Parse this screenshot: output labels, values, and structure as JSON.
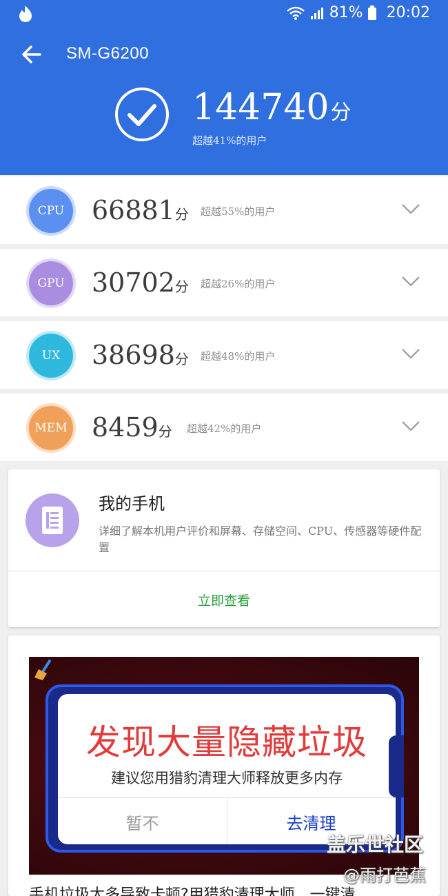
{
  "status_bar": {
    "battery": "81%",
    "time": "20:02",
    "icons": [
      "flame-icon",
      "wifi-icon",
      "signal-icon",
      "battery-icon"
    ]
  },
  "header": {
    "device": "SM-G6200",
    "total_score": "144740",
    "score_unit": "分",
    "beat_text": "超越41%的用户",
    "colors": {
      "background": "#2f6fe0"
    }
  },
  "scores": [
    {
      "badge": "CPU",
      "score": "66881",
      "unit": "分",
      "beat": "超越55%的用户"
    },
    {
      "badge": "GPU",
      "score": "30702",
      "unit": "分",
      "beat": "超越26%的用户"
    },
    {
      "badge": "UX",
      "score": "38698",
      "unit": "分",
      "beat": "超越48%的用户"
    },
    {
      "badge": "MEM",
      "score": "8459",
      "unit": "分",
      "beat": "超越42%的用户"
    }
  ],
  "my_phone_card": {
    "title": "我的手机",
    "description": "详细了解本机用户评价和屏幕、存储空间、CPU、传感器等硬件配置",
    "action": "立即查看"
  },
  "ad": {
    "headline": "发现大量隐藏垃圾",
    "subline": "建议您用猎豹清理大师释放更多内存",
    "cancel_button": "暂不",
    "confirm_button": "去清理",
    "teaser": "手机垃圾太多导致卡顿?用猎豹清理大师，一键清"
  },
  "watermark": {
    "line1": "盖乐世社区",
    "line2": "@雨打芭蕉"
  }
}
